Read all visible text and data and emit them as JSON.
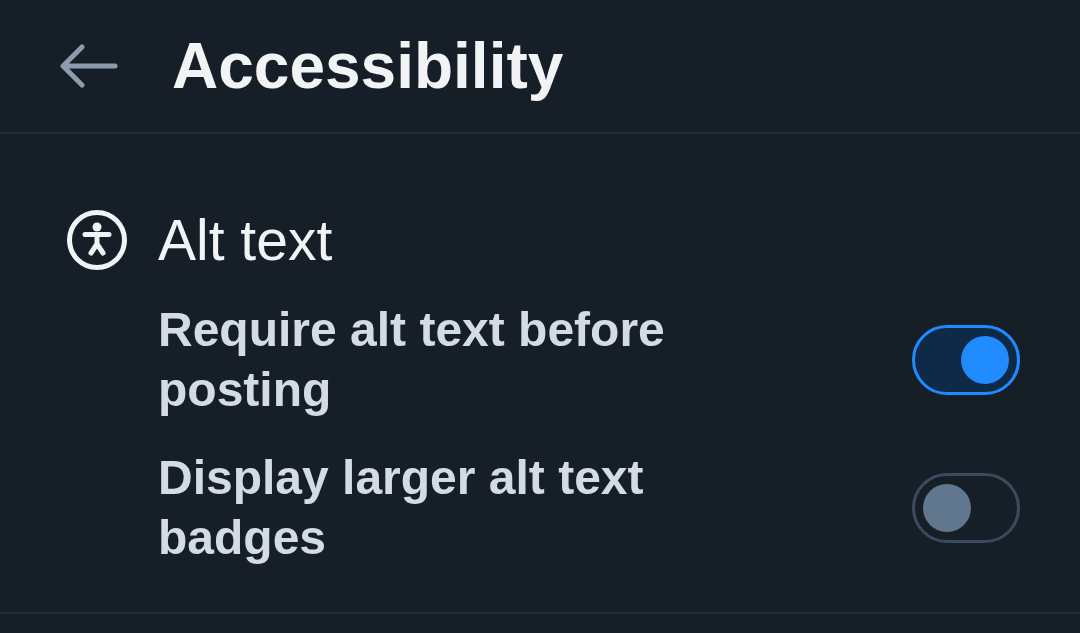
{
  "header": {
    "title": "Accessibility"
  },
  "sections": [
    {
      "title": "Alt text",
      "settings": [
        {
          "label": "Require alt text before posting",
          "on": true
        },
        {
          "label": "Display larger alt text badges",
          "on": false
        }
      ]
    }
  ]
}
